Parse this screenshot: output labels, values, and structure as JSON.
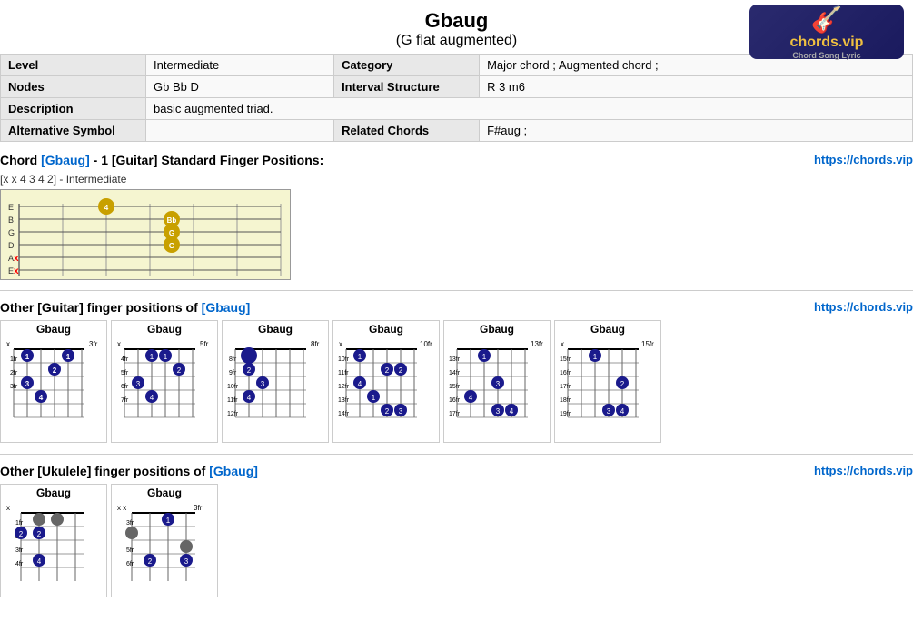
{
  "header": {
    "title": "Gbaug",
    "subtitle": "(G flat augmented)",
    "logo_text": "chords.vip",
    "logo_sub": "Chord Song Lyric"
  },
  "info": {
    "level_label": "Level",
    "level_value": "Intermediate",
    "category_label": "Category",
    "category_value": "Major chord ; Augmented chord ;",
    "nodes_label": "Nodes",
    "nodes_value": "Gb Bb D",
    "interval_label": "Interval Structure",
    "interval_value": "R 3 m6",
    "description_label": "Description",
    "description_value": "basic augmented triad.",
    "alt_symbol_label": "Alternative Symbol",
    "related_label": "Related Chords",
    "related_value": "F#aug ;"
  },
  "chord_section": {
    "prefix": "Chord",
    "chord_ref": "[Gbaug]",
    "suffix": "- 1 [Guitar] Standard Finger Positions:",
    "url": "https://chords.vip",
    "diagram_label": "[x x 4 3 4 2] - Intermediate"
  },
  "other_guitar": {
    "prefix": "Other [Guitar] finger positions of",
    "chord_ref": "[Gbaug]",
    "url": "https://chords.vip"
  },
  "other_ukulele": {
    "prefix": "Other [Ukulele] finger positions of",
    "chord_ref": "[Gbaug]",
    "url": "https://chords.vip"
  },
  "guitar_cards": [
    {
      "title": "Gbaug",
      "x_marks": "x",
      "start_fret": "3fr"
    },
    {
      "title": "Gbaug",
      "x_marks": "x",
      "start_fret": "5fr"
    },
    {
      "title": "Gbaug",
      "x_marks": "",
      "start_fret": "8fr"
    },
    {
      "title": "Gbaug",
      "x_marks": "x",
      "start_fret": "10fr"
    },
    {
      "title": "Gbaug",
      "x_marks": "",
      "start_fret": "13fr"
    },
    {
      "title": "Gbaug",
      "x_marks": "x",
      "start_fret": "15fr"
    }
  ],
  "ukulele_cards": [
    {
      "title": "Gbaug",
      "x_marks": "x"
    },
    {
      "title": "Gbaug",
      "x_marks": "x x",
      "start_fret": "3fr"
    }
  ]
}
